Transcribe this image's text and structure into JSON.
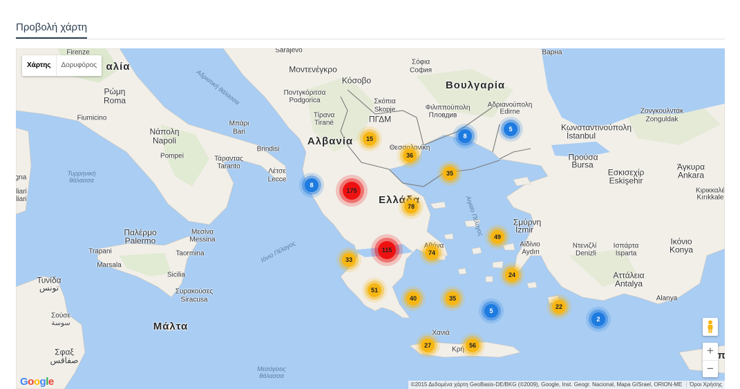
{
  "section": {
    "title": "Προβολή χάρτη"
  },
  "map": {
    "type_control": {
      "map_label": "Χάρτης",
      "satellite_label": "Δορυφόρος",
      "active": "map"
    },
    "attribution": "©2015 Δεδομένα χάρτη GeoBasis-DE/BKG (©2009), Google, Inst. Geogr. Nacional, Mapa GISrael, ORION-ME",
    "terms": "Όροι Χρήσης",
    "logo": "Google",
    "zoom_in": "+",
    "zoom_out": "−",
    "colors": {
      "water": "#a9cdf3",
      "land": "#f2efe9",
      "green": "#d6e6c3",
      "yellow_cluster": "#f7b613",
      "blue_cluster": "#1e7be0",
      "red_cluster": "#ee1111"
    },
    "labels": [
      {
        "id": "firenze",
        "text": "Firenze",
        "cls": ""
      },
      {
        "id": "italia",
        "text": "αλία",
        "cls": "country"
      },
      {
        "id": "rwmh",
        "text": "Ρώμη",
        "cls": "big"
      },
      {
        "id": "roma",
        "text": "Roma",
        "cls": "big"
      },
      {
        "id": "fiumicino",
        "text": "Fiumicino",
        "cls": ""
      },
      {
        "id": "napoli_gr",
        "text": "Νάπολη",
        "cls": "big"
      },
      {
        "id": "napoli",
        "text": "Napoli",
        "cls": "big"
      },
      {
        "id": "pompei",
        "text": "Pompei",
        "cls": ""
      },
      {
        "id": "bari_gr",
        "text": "Μπάρι",
        "cls": ""
      },
      {
        "id": "bari",
        "text": "Bari",
        "cls": ""
      },
      {
        "id": "brindisi",
        "text": "Brindisi",
        "cls": ""
      },
      {
        "id": "taranto_gr",
        "text": "Τάραντας",
        "cls": ""
      },
      {
        "id": "taranto",
        "text": "Taranto",
        "cls": ""
      },
      {
        "id": "lecce_gr",
        "text": "Λέτσε",
        "cls": ""
      },
      {
        "id": "lecce",
        "text": "Lecce",
        "cls": ""
      },
      {
        "id": "tyrrhenian",
        "text": "Τυρρηνική\nθάλασσα",
        "cls": "sea"
      },
      {
        "id": "gna",
        "text": "gna",
        "cls": ""
      },
      {
        "id": "liari",
        "text": "liari\nliari",
        "cls": ""
      },
      {
        "id": "palermo_gr",
        "text": "Παλέρμο",
        "cls": "big"
      },
      {
        "id": "palermo",
        "text": "Palermo",
        "cls": "big"
      },
      {
        "id": "messina_gr",
        "text": "Μεσίνα",
        "cls": ""
      },
      {
        "id": "messina",
        "text": "Messina",
        "cls": ""
      },
      {
        "id": "trapani",
        "text": "Trapani",
        "cls": ""
      },
      {
        "id": "taormina",
        "text": "Taormina",
        "cls": ""
      },
      {
        "id": "marsala",
        "text": "Marsala",
        "cls": ""
      },
      {
        "id": "sicilia",
        "text": "Sicilia",
        "cls": ""
      },
      {
        "id": "siracusa_gr",
        "text": "Συρακούσες",
        "cls": ""
      },
      {
        "id": "siracusa",
        "text": "Siracusa",
        "cls": ""
      },
      {
        "id": "tunis_gr",
        "text": "Τυνίδα",
        "cls": "big"
      },
      {
        "id": "tunis_ar",
        "text": "تونس",
        "cls": "big"
      },
      {
        "id": "sousse_gr",
        "text": "Σούσε",
        "cls": ""
      },
      {
        "id": "sousse_ar",
        "text": "سوسة",
        "cls": ""
      },
      {
        "id": "sfax_gr",
        "text": "Σφαξ",
        "cls": "big"
      },
      {
        "id": "sfax_ar",
        "text": "صفاقس",
        "cls": "big"
      },
      {
        "id": "malta",
        "text": "Μάλτα",
        "cls": "country"
      },
      {
        "id": "mediterranean",
        "text": "Μεσόγειος\nθάλασσα",
        "cls": "sea"
      },
      {
        "id": "ionian",
        "text": "Ιόνιο Πέλαγος",
        "cls": "sea"
      },
      {
        "id": "adriatic",
        "text": "Αδριατική θάλασσα",
        "cls": "sea"
      },
      {
        "id": "aegean",
        "text": "Αιγαίο Πέλαγος",
        "cls": "sea"
      },
      {
        "id": "sarajevo",
        "text": "Sarajevo",
        "cls": ""
      },
      {
        "id": "montenegro",
        "text": "Μοντενέγκρο",
        "cls": "big"
      },
      {
        "id": "podgorica",
        "text": "Ποντγκόριτσα\nPodgorica",
        "cls": ""
      },
      {
        "id": "kosovo",
        "text": "Κόσοβο",
        "cls": "big"
      },
      {
        "id": "albania",
        "text": "Αλβανία",
        "cls": "country"
      },
      {
        "id": "tirana_gr",
        "text": "Τίρανα",
        "cls": ""
      },
      {
        "id": "tirana",
        "text": "Tiranë",
        "cls": ""
      },
      {
        "id": "skopje_gr",
        "text": "Σκόπια",
        "cls": ""
      },
      {
        "id": "skopje",
        "text": "Skopje",
        "cls": ""
      },
      {
        "id": "pgdm",
        "text": "ΠΓΔΜ",
        "cls": "big"
      },
      {
        "id": "sofia_gr",
        "text": "Σόφια",
        "cls": ""
      },
      {
        "id": "sofia",
        "text": "София",
        "cls": ""
      },
      {
        "id": "bulgaria",
        "text": "Βουλγαρία",
        "cls": "country"
      },
      {
        "id": "plovdiv_gr",
        "text": "Φιλιππούπολη",
        "cls": ""
      },
      {
        "id": "plovdiv",
        "text": "Пловдив",
        "cls": ""
      },
      {
        "id": "edirne_gr",
        "text": "Αδριανούπολη",
        "cls": ""
      },
      {
        "id": "edirne",
        "text": "Edirne",
        "cls": ""
      },
      {
        "id": "varna",
        "text": "Варна",
        "cls": ""
      },
      {
        "id": "istanbul_gr",
        "text": "Κωνσταντινούπολη",
        "cls": "big"
      },
      {
        "id": "istanbul",
        "text": "İstanbul",
        "cls": "big"
      },
      {
        "id": "zonguldak_gr",
        "text": "Ζονγκουλντάκ",
        "cls": ""
      },
      {
        "id": "zonguldak",
        "text": "Zonguldak",
        "cls": ""
      },
      {
        "id": "thessaloniki",
        "text": "Θεσσαλονίκη",
        "cls": ""
      },
      {
        "id": "greece",
        "text": "Ελλάδα",
        "cls": "country"
      },
      {
        "id": "athens",
        "text": "Αθήνα",
        "cls": ""
      },
      {
        "id": "prusa_gr",
        "text": "Προύσα",
        "cls": "big"
      },
      {
        "id": "bursa",
        "text": "Bursa",
        "cls": "big"
      },
      {
        "id": "eskisehir_gr",
        "text": "Εσκισεχίρ",
        "cls": "big"
      },
      {
        "id": "eskisehir",
        "text": "Eskişehir",
        "cls": "big"
      },
      {
        "id": "ankara_gr",
        "text": "Άγκυρα",
        "cls": "big"
      },
      {
        "id": "ankara",
        "text": "Ankara",
        "cls": "big"
      },
      {
        "id": "kirikkale_gr",
        "text": "Κιρικκαλέ",
        "cls": ""
      },
      {
        "id": "kirikkale",
        "text": "Kırıkkale",
        "cls": ""
      },
      {
        "id": "smyrni_gr",
        "text": "Σμύρνη",
        "cls": "big"
      },
      {
        "id": "izmir",
        "text": "İzmir",
        "cls": "big"
      },
      {
        "id": "aydin_gr",
        "text": "Αϊδίνιο",
        "cls": ""
      },
      {
        "id": "aydin",
        "text": "Aydın",
        "cls": ""
      },
      {
        "id": "denizli_gr",
        "text": "Ντενιζλί",
        "cls": ""
      },
      {
        "id": "denizli",
        "text": "Denizli",
        "cls": ""
      },
      {
        "id": "isparta_gr",
        "text": "Ισπάρτα",
        "cls": ""
      },
      {
        "id": "isparta",
        "text": "Isparta",
        "cls": ""
      },
      {
        "id": "konya_gr",
        "text": "Ικόνιο",
        "cls": "big"
      },
      {
        "id": "konya",
        "text": "Konya",
        "cls": "big"
      },
      {
        "id": "antalya_gr",
        "text": "Αττάλεια",
        "cls": "big"
      },
      {
        "id": "antalya",
        "text": "Antalya",
        "cls": "big"
      },
      {
        "id": "alanya",
        "text": "Alanya",
        "cls": ""
      },
      {
        "id": "chania",
        "text": "Χανιά",
        "cls": ""
      },
      {
        "id": "kriti",
        "text": "Κρή",
        "cls": ""
      },
      {
        "id": "kypros",
        "text": "Κύπ",
        "cls": "country"
      }
    ],
    "clusters": [
      {
        "count": "15",
        "color": "yellow"
      },
      {
        "count": "36",
        "color": "yellow"
      },
      {
        "count": "8",
        "color": "blue"
      },
      {
        "count": "5",
        "color": "blue"
      },
      {
        "count": "35",
        "color": "yellow"
      },
      {
        "count": "8",
        "color": "blue"
      },
      {
        "count": "175",
        "color": "red"
      },
      {
        "count": "78",
        "color": "yellow"
      },
      {
        "count": "49",
        "color": "yellow"
      },
      {
        "count": "115",
        "color": "red"
      },
      {
        "count": "74",
        "color": "yellow"
      },
      {
        "count": "33",
        "color": "yellow"
      },
      {
        "count": "24",
        "color": "yellow"
      },
      {
        "count": "51",
        "color": "yellow"
      },
      {
        "count": "40",
        "color": "yellow"
      },
      {
        "count": "35",
        "color": "yellow"
      },
      {
        "count": "5",
        "color": "blue"
      },
      {
        "count": "22",
        "color": "yellow"
      },
      {
        "count": "2",
        "color": "blue"
      },
      {
        "count": "27",
        "color": "yellow"
      },
      {
        "count": "56",
        "color": "yellow"
      }
    ]
  }
}
